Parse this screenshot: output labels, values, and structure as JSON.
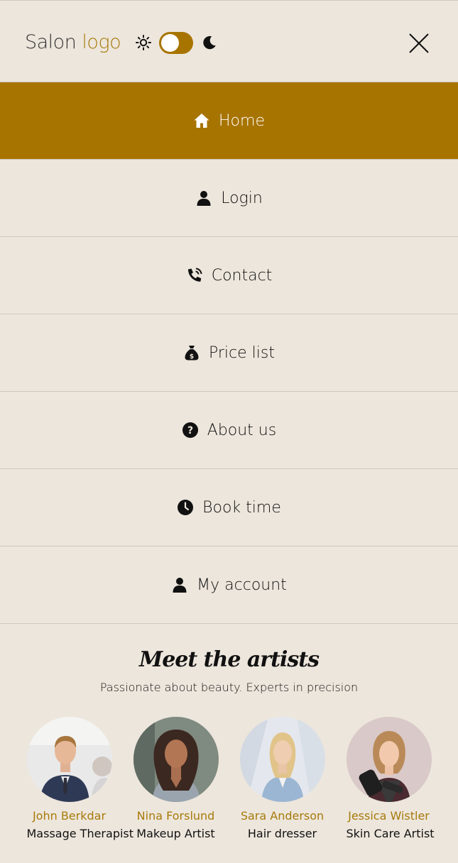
{
  "header": {
    "logo_main": "Salon",
    "logo_accent": "logo",
    "theme_toggle_on": false
  },
  "colors": {
    "accent": "#a87400",
    "background": "#ede6dc",
    "name_accent": "#a77a0c"
  },
  "nav": {
    "items": [
      {
        "label": "Home",
        "icon": "home-icon",
        "active": true
      },
      {
        "label": "Login",
        "icon": "user-icon",
        "active": false
      },
      {
        "label": "Contact",
        "icon": "phone-icon",
        "active": false
      },
      {
        "label": "Price list",
        "icon": "money-bag-icon",
        "active": false
      },
      {
        "label": "About us",
        "icon": "question-icon",
        "active": false
      },
      {
        "label": "Book time",
        "icon": "clock-icon",
        "active": false
      },
      {
        "label": "My account",
        "icon": "user-icon",
        "active": false
      }
    ]
  },
  "artists": {
    "title": "Meet the artists",
    "subtitle": "Passionate about beauty. Experts in precision",
    "list": [
      {
        "name": "John Berkdar",
        "role": "Massage Therapist"
      },
      {
        "name": "Nina Forslund",
        "role": "Makeup Artist"
      },
      {
        "name": "Sara Anderson",
        "role": "Hair dresser"
      },
      {
        "name": "Jessica Wistler",
        "role": "Skin Care Artist"
      }
    ]
  }
}
